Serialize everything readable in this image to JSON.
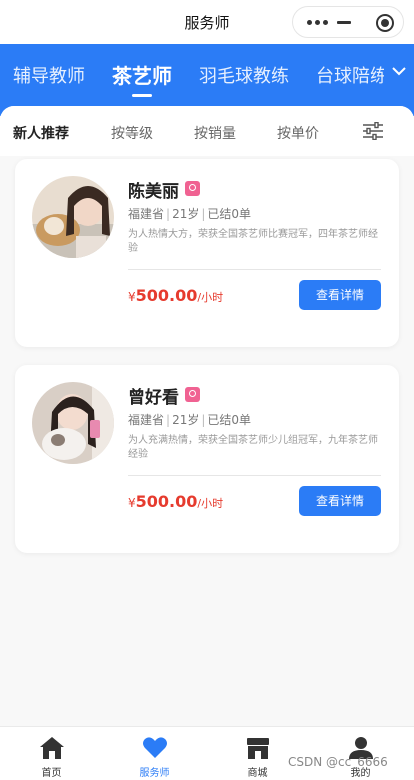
{
  "window": {
    "title": "服务师"
  },
  "categories": [
    "辅导教师",
    "茶艺师",
    "羽毛球教练",
    "台球陪练"
  ],
  "active_category": "茶艺师",
  "filters": [
    "新人推荐",
    "按等级",
    "按销量",
    "按单价"
  ],
  "active_filter": "新人推荐",
  "cards": [
    {
      "name": "陈美丽",
      "province": "福建省",
      "age": "21岁",
      "orders": "已结0单",
      "description": "为人热情大方，荣获全国茶艺师比赛冠军，四年茶艺师经验",
      "currency": "¥",
      "price": "500.00",
      "unit": "/小时",
      "button": "查看详情"
    },
    {
      "name": "曾好看",
      "province": "福建省",
      "age": "21岁",
      "orders": "已结0单",
      "description": "为人充满热情，荣获全国茶艺师少儿组冠军，九年茶艺师经验",
      "currency": "¥",
      "price": "500.00",
      "unit": "/小时",
      "button": "查看详情"
    }
  ],
  "tabbar": [
    {
      "label": "首页",
      "icon": "home-icon"
    },
    {
      "label": "服务师",
      "icon": "heart-icon"
    },
    {
      "label": "商城",
      "icon": "store-icon"
    },
    {
      "label": "我的",
      "icon": "user-icon"
    }
  ],
  "active_tab": "服务师",
  "watermark": "CSDN @cc_6666",
  "colors": {
    "primary": "#2b7cf6",
    "price": "#e63b2e",
    "badge": "#f06292"
  }
}
